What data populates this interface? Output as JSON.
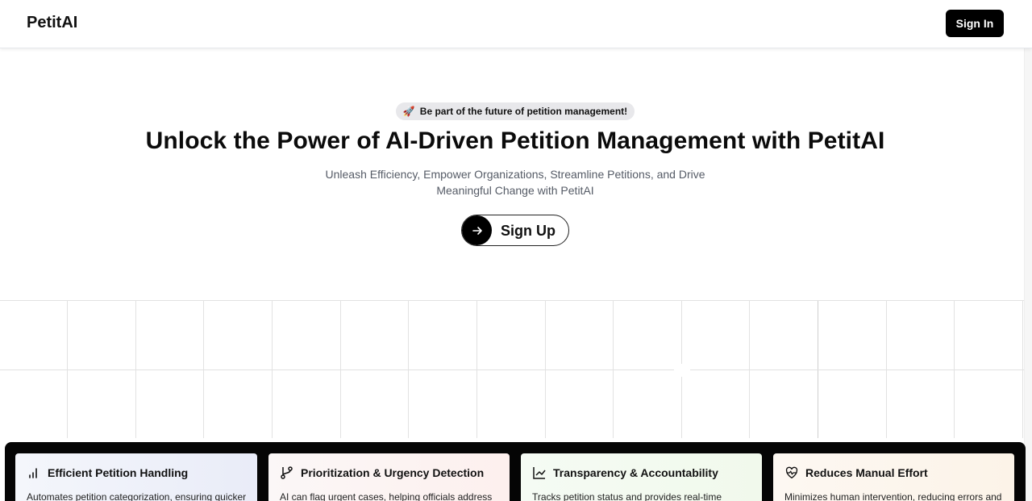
{
  "header": {
    "logo": "PetitAI",
    "signin_label": "Sign In"
  },
  "hero": {
    "badge_icon": "rocket-icon",
    "badge_text": "Be part of the future of petition management!",
    "title": "Unlock the Power of AI-Driven Petition Management with PetitAI",
    "subtitle": "Unleash Efficiency, Empower Organizations, Streamline Petitions, and Drive Meaningful Change with PetitAI",
    "signup_label": "Sign Up",
    "signup_icon": "arrow-right-icon"
  },
  "features": [
    {
      "icon": "bar-chart-icon",
      "title": "Efficient Petition Handling",
      "desc": "Automates petition categorization, ensuring quicker"
    },
    {
      "icon": "git-branch-icon",
      "title": "Prioritization & Urgency Detection",
      "desc": "AI can flag urgent cases, helping officials address"
    },
    {
      "icon": "line-chart-icon",
      "title": "Transparency & Accountability",
      "desc": "Tracks petition status and provides real-time"
    },
    {
      "icon": "heart-pulse-icon",
      "title": "Reduces Manual Effort",
      "desc": "Minimizes human intervention, reducing errors and"
    }
  ],
  "colors": {
    "primary": "#000000",
    "text": "#111111",
    "muted": "#555b66",
    "badge_bg": "#e8e8eb"
  }
}
